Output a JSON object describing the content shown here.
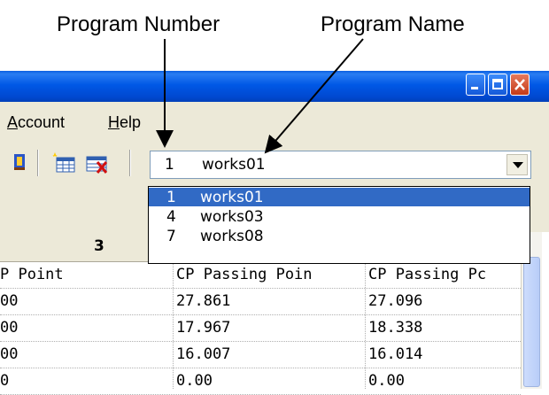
{
  "annotations": {
    "program_number": "Program Number",
    "program_name": "Program Name"
  },
  "menu": {
    "account": {
      "prefix": "A",
      "rest": "ccount"
    },
    "help": {
      "prefix": "H",
      "rest": "elp"
    }
  },
  "combo": {
    "number": "1",
    "name": "works01"
  },
  "dropdown": [
    {
      "number": "1",
      "name": "works01",
      "selected": true
    },
    {
      "number": "4",
      "name": "works03",
      "selected": false
    },
    {
      "number": "7",
      "name": "works08",
      "selected": false
    }
  ],
  "grid": {
    "header": "3",
    "columns": [
      "P Point",
      "CP Passing Poin",
      "CP Passing Pc"
    ],
    "rows": [
      [
        "00",
        "27.861",
        "27.096"
      ],
      [
        "00",
        "17.967",
        "18.338"
      ],
      [
        "00",
        "16.007",
        "16.014"
      ],
      [
        "0",
        "0.00",
        "0.00"
      ]
    ]
  },
  "colors": {
    "titlebar": "#0058e6",
    "selection": "#316ac5",
    "chrome": "#ece9d8"
  }
}
